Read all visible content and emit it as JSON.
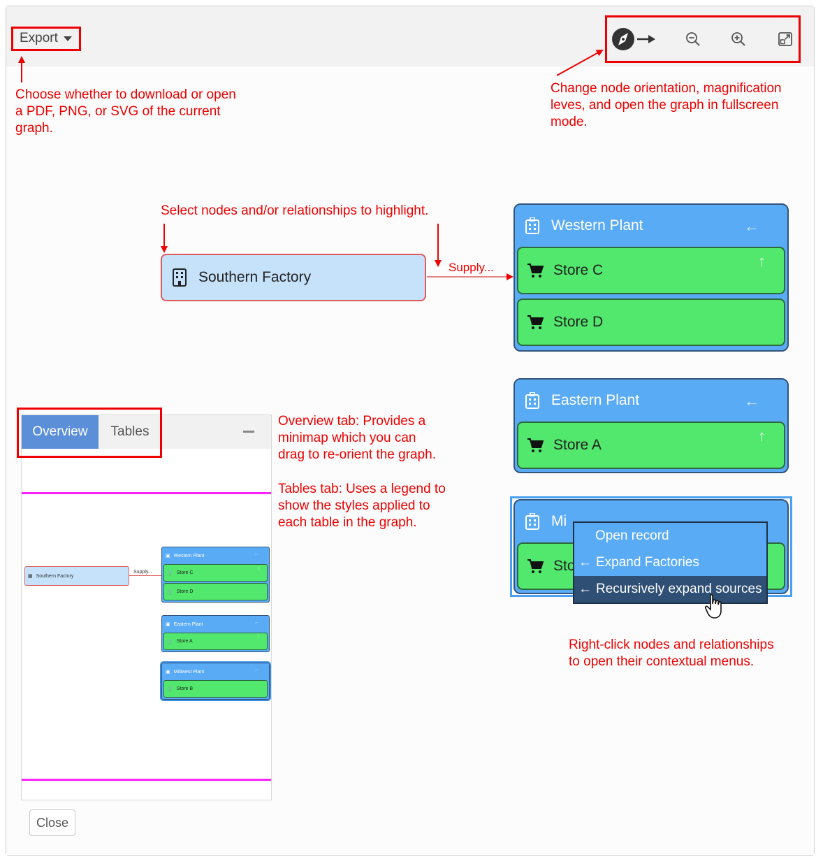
{
  "toolbar": {
    "export_label": "Export"
  },
  "annotations": {
    "export": [
      "Choose whether to download or open",
      "a PDF, PNG, or SVG of the current",
      "graph."
    ],
    "tools": [
      "Change node orientation, magnification",
      "leves, and open the graph in fullscreen",
      "mode."
    ],
    "select": "Select nodes and/or relationships to highlight.",
    "overview": [
      "Overview tab: Provides a",
      "minimap which you can",
      "drag to re-orient the graph."
    ],
    "tables": [
      "Tables tab: Uses a legend to",
      "show the styles applied to",
      "each table in the graph."
    ],
    "rightclick": [
      "Right-click nodes and relationships",
      "to open their contextual menus."
    ]
  },
  "graph": {
    "source_node": "Southern Factory",
    "edge_label": "Supply...",
    "plants": [
      {
        "name": "Western Plant",
        "stores": [
          "Store C",
          "Store D"
        ]
      },
      {
        "name": "Eastern Plant",
        "stores": [
          "Store A"
        ]
      },
      {
        "name": "Midwest Plant",
        "stores": [
          "Store B"
        ]
      }
    ],
    "selected_plant_partial_title": "Mi",
    "selected_store_partial": "Sto"
  },
  "context_menu": {
    "items": [
      "Open record",
      "Expand Factories",
      "Recursively expand sources"
    ],
    "highlighted_index": 2
  },
  "overview_panel": {
    "tabs": [
      "Overview",
      "Tables"
    ],
    "active_tab": "Overview",
    "minimap_edge_label": "Supply..."
  },
  "footer": {
    "close_label": "Close"
  },
  "colors": {
    "annotation": "#ee0000",
    "plant": "#5aabf5",
    "store": "#52e86d",
    "source_node": "#c6e2fb",
    "active_tab": "#5b8fd8",
    "minimap_bounds": "#ff22ff"
  },
  "icons": {
    "compass": "compass-icon",
    "zoom_out": "zoom-out-icon",
    "zoom_in": "zoom-in-icon",
    "fullscreen": "fullscreen-icon",
    "factory": "building-icon",
    "plant": "plant-building-icon",
    "store": "cart-icon",
    "back_arrow": "arrow-left-icon",
    "up_arrow": "arrow-up-icon",
    "cursor": "hand-pointer-icon"
  }
}
